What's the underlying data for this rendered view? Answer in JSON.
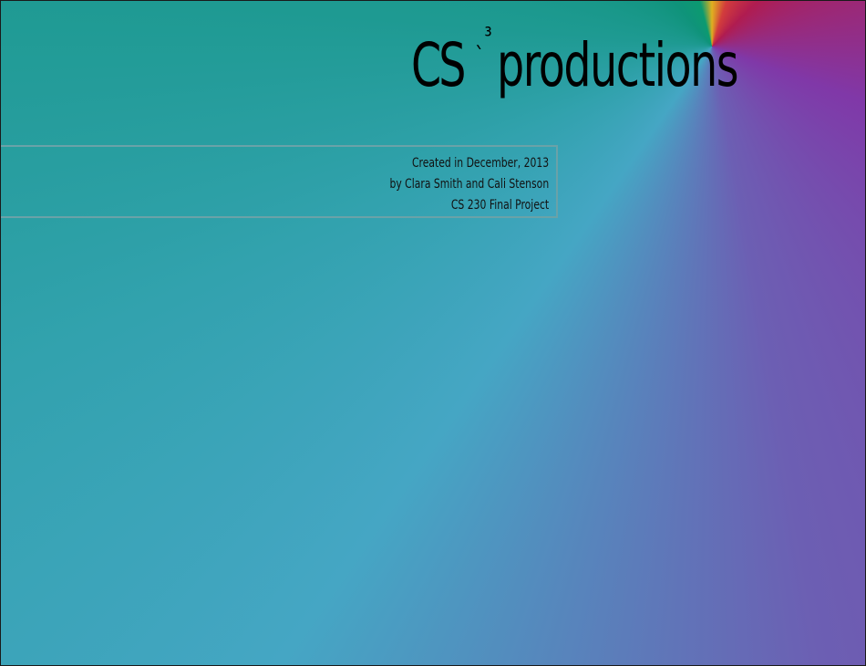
{
  "logo": {
    "prefix": "CS",
    "superscript": "ˎ³",
    "suffix": "productions"
  },
  "credits": {
    "line1": "Created in December, 2013",
    "line2": "by Clara Smith and Cali Stenson",
    "line3": "CS 230 Final Project"
  },
  "colors": {
    "teal": "#0f937a",
    "sky": "#45a6c4",
    "purple": "#8038a8",
    "crimson": "#b01c50",
    "gold": "#e0b020",
    "box_border": "#6aa2a8"
  }
}
